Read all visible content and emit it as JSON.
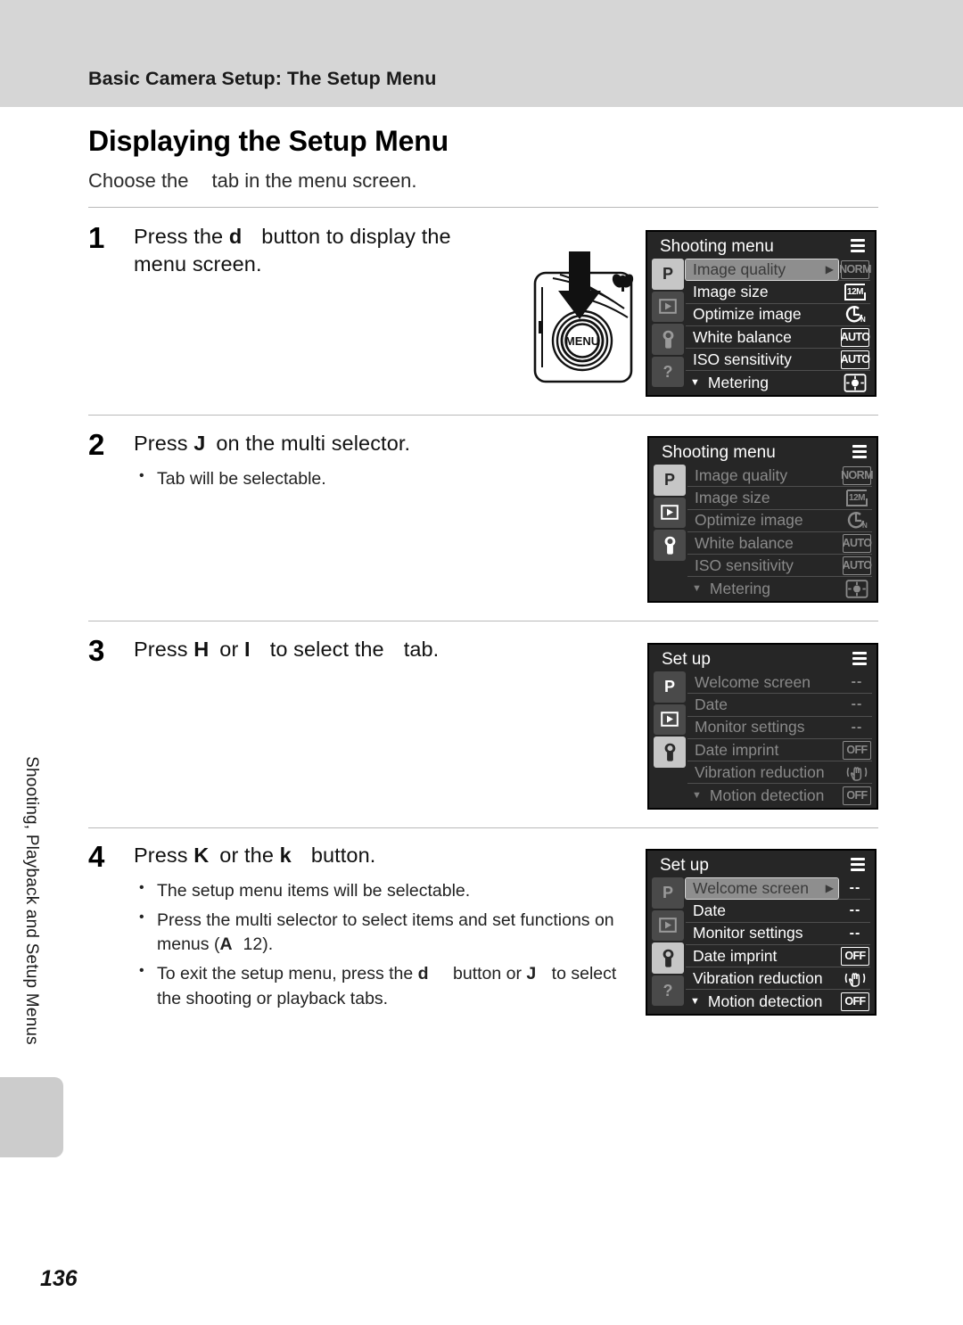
{
  "header": {
    "breadcrumb": "Basic Camera Setup: The Setup Menu"
  },
  "side_tab": {
    "label": "Shooting, Playback and Setup Menus"
  },
  "page": {
    "title": "Displaying the Setup Menu",
    "lead_before": "Choose the",
    "lead_after": "tab in the menu screen.",
    "number": "136"
  },
  "steps": [
    {
      "number": "1",
      "head_a": "Press the",
      "head_symbol": "d",
      "head_b": "button to display the",
      "head_line2": "menu screen.",
      "bullets": []
    },
    {
      "number": "2",
      "head_a": "Press",
      "head_symbol": "J",
      "head_b": "on the multi selector.",
      "bullets": [
        "Tab will be selectable."
      ]
    },
    {
      "number": "3",
      "head_a": "Press",
      "head_symbol": "H",
      "head_mid": "or",
      "head_symbol2": "I",
      "head_b": "to select the",
      "head_c": "tab.",
      "bullets": []
    },
    {
      "number": "4",
      "head_a": "Press",
      "head_symbol": "K",
      "head_mid": "or the",
      "head_symbol2": "k",
      "head_b": "button.",
      "bullets_rich": [
        {
          "text": "The setup menu items will be selectable."
        },
        {
          "pre": "Press the multi selector to select items and set functions on menus (",
          "sym": "A",
          "post": "12)."
        },
        {
          "pre": "To exit the setup menu, press the ",
          "sym": "d",
          "mid": " button or ",
          "sym2": "J",
          "post": " to select the shooting or playback tabs."
        }
      ]
    }
  ],
  "camera_illustration": {
    "button_label": "MENU",
    "arrow": "down-arrow"
  },
  "screens": [
    {
      "id": "screen-1",
      "title": "Shooting menu",
      "tabs": [
        {
          "icon": "P",
          "state": "selected"
        },
        {
          "icon": "playback",
          "state": "dim"
        },
        {
          "icon": "wrench",
          "state": "dim"
        },
        {
          "icon": "question",
          "state": "dim"
        }
      ],
      "rows": [
        {
          "label": "Image quality",
          "value": "NORM",
          "value_type": "text",
          "highlighted": true,
          "dimmed": true,
          "arrow": true
        },
        {
          "label": "Image size",
          "value": "12M",
          "value_type": "icon-12m",
          "highlighted": false,
          "dimmed": false
        },
        {
          "label": "Optimize image",
          "value": "optimize",
          "value_type": "icon-optimize",
          "highlighted": false,
          "dimmed": false
        },
        {
          "label": "White balance",
          "value": "AUTO",
          "value_type": "text",
          "highlighted": false,
          "dimmed": false
        },
        {
          "label": "ISO sensitivity",
          "value": "AUTO",
          "value_type": "text",
          "highlighted": false,
          "dimmed": false
        },
        {
          "label": "Metering",
          "value": "metering",
          "value_type": "icon-metering",
          "highlighted": false,
          "dimmed": false,
          "caret": true
        }
      ]
    },
    {
      "id": "screen-2",
      "title": "Shooting menu",
      "tabs": [
        {
          "icon": "P",
          "state": "selected"
        },
        {
          "icon": "playback",
          "state": "bright"
        },
        {
          "icon": "wrench",
          "state": "bright"
        },
        {
          "icon": "none",
          "state": "none"
        }
      ],
      "rows": [
        {
          "label": "Image quality",
          "value": "NORM",
          "value_type": "text",
          "highlighted": false,
          "dimmed": true
        },
        {
          "label": "Image size",
          "value": "12M",
          "value_type": "icon-12m",
          "highlighted": false,
          "dimmed": true
        },
        {
          "label": "Optimize image",
          "value": "optimize",
          "value_type": "icon-optimize",
          "highlighted": false,
          "dimmed": true
        },
        {
          "label": "White balance",
          "value": "AUTO",
          "value_type": "text",
          "highlighted": false,
          "dimmed": true
        },
        {
          "label": "ISO sensitivity",
          "value": "AUTO",
          "value_type": "text",
          "highlighted": false,
          "dimmed": true
        },
        {
          "label": "Metering",
          "value": "metering",
          "value_type": "icon-metering",
          "highlighted": false,
          "dimmed": true,
          "caret": true
        }
      ]
    },
    {
      "id": "screen-3",
      "title": "Set up",
      "tabs": [
        {
          "icon": "P",
          "state": "bright"
        },
        {
          "icon": "playback",
          "state": "bright"
        },
        {
          "icon": "wrench",
          "state": "selected"
        },
        {
          "icon": "none",
          "state": "none"
        }
      ],
      "rows": [
        {
          "label": "Welcome screen",
          "value": "--",
          "value_type": "dashes",
          "highlighted": false,
          "dimmed": true
        },
        {
          "label": "Date",
          "value": "--",
          "value_type": "dashes",
          "highlighted": false,
          "dimmed": true
        },
        {
          "label": "Monitor settings",
          "value": "--",
          "value_type": "dashes",
          "highlighted": false,
          "dimmed": true
        },
        {
          "label": "Date imprint",
          "value": "OFF",
          "value_type": "text",
          "highlighted": false,
          "dimmed": true
        },
        {
          "label": "Vibration reduction",
          "value": "vr",
          "value_type": "icon-vr",
          "highlighted": false,
          "dimmed": true
        },
        {
          "label": "Motion detection",
          "value": "OFF",
          "value_type": "text",
          "highlighted": false,
          "dimmed": true,
          "caret": true
        }
      ]
    },
    {
      "id": "screen-4",
      "title": "Set up",
      "tabs": [
        {
          "icon": "P",
          "state": "dim"
        },
        {
          "icon": "playback",
          "state": "dim"
        },
        {
          "icon": "wrench",
          "state": "selected"
        },
        {
          "icon": "question",
          "state": "dim"
        }
      ],
      "rows": [
        {
          "label": "Welcome screen",
          "value": "--",
          "value_type": "dashes",
          "highlighted": true,
          "dimmed": false,
          "arrow": true
        },
        {
          "label": "Date",
          "value": "--",
          "value_type": "dashes",
          "highlighted": false,
          "dimmed": false
        },
        {
          "label": "Monitor settings",
          "value": "--",
          "value_type": "dashes",
          "highlighted": false,
          "dimmed": false
        },
        {
          "label": "Date imprint",
          "value": "OFF",
          "value_type": "text",
          "highlighted": false,
          "dimmed": false
        },
        {
          "label": "Vibration reduction",
          "value": "vr",
          "value_type": "icon-vr",
          "highlighted": false,
          "dimmed": false
        },
        {
          "label": "Motion detection",
          "value": "OFF",
          "value_type": "text",
          "highlighted": false,
          "dimmed": false,
          "caret": true
        }
      ]
    }
  ],
  "colors": {
    "header_band": "#d6d6d6",
    "lcd_background": "#262626",
    "lcd_highlight": "#8e8e8e",
    "rule": "#b9b9b9",
    "side_tab_gray": "#cccccc"
  }
}
